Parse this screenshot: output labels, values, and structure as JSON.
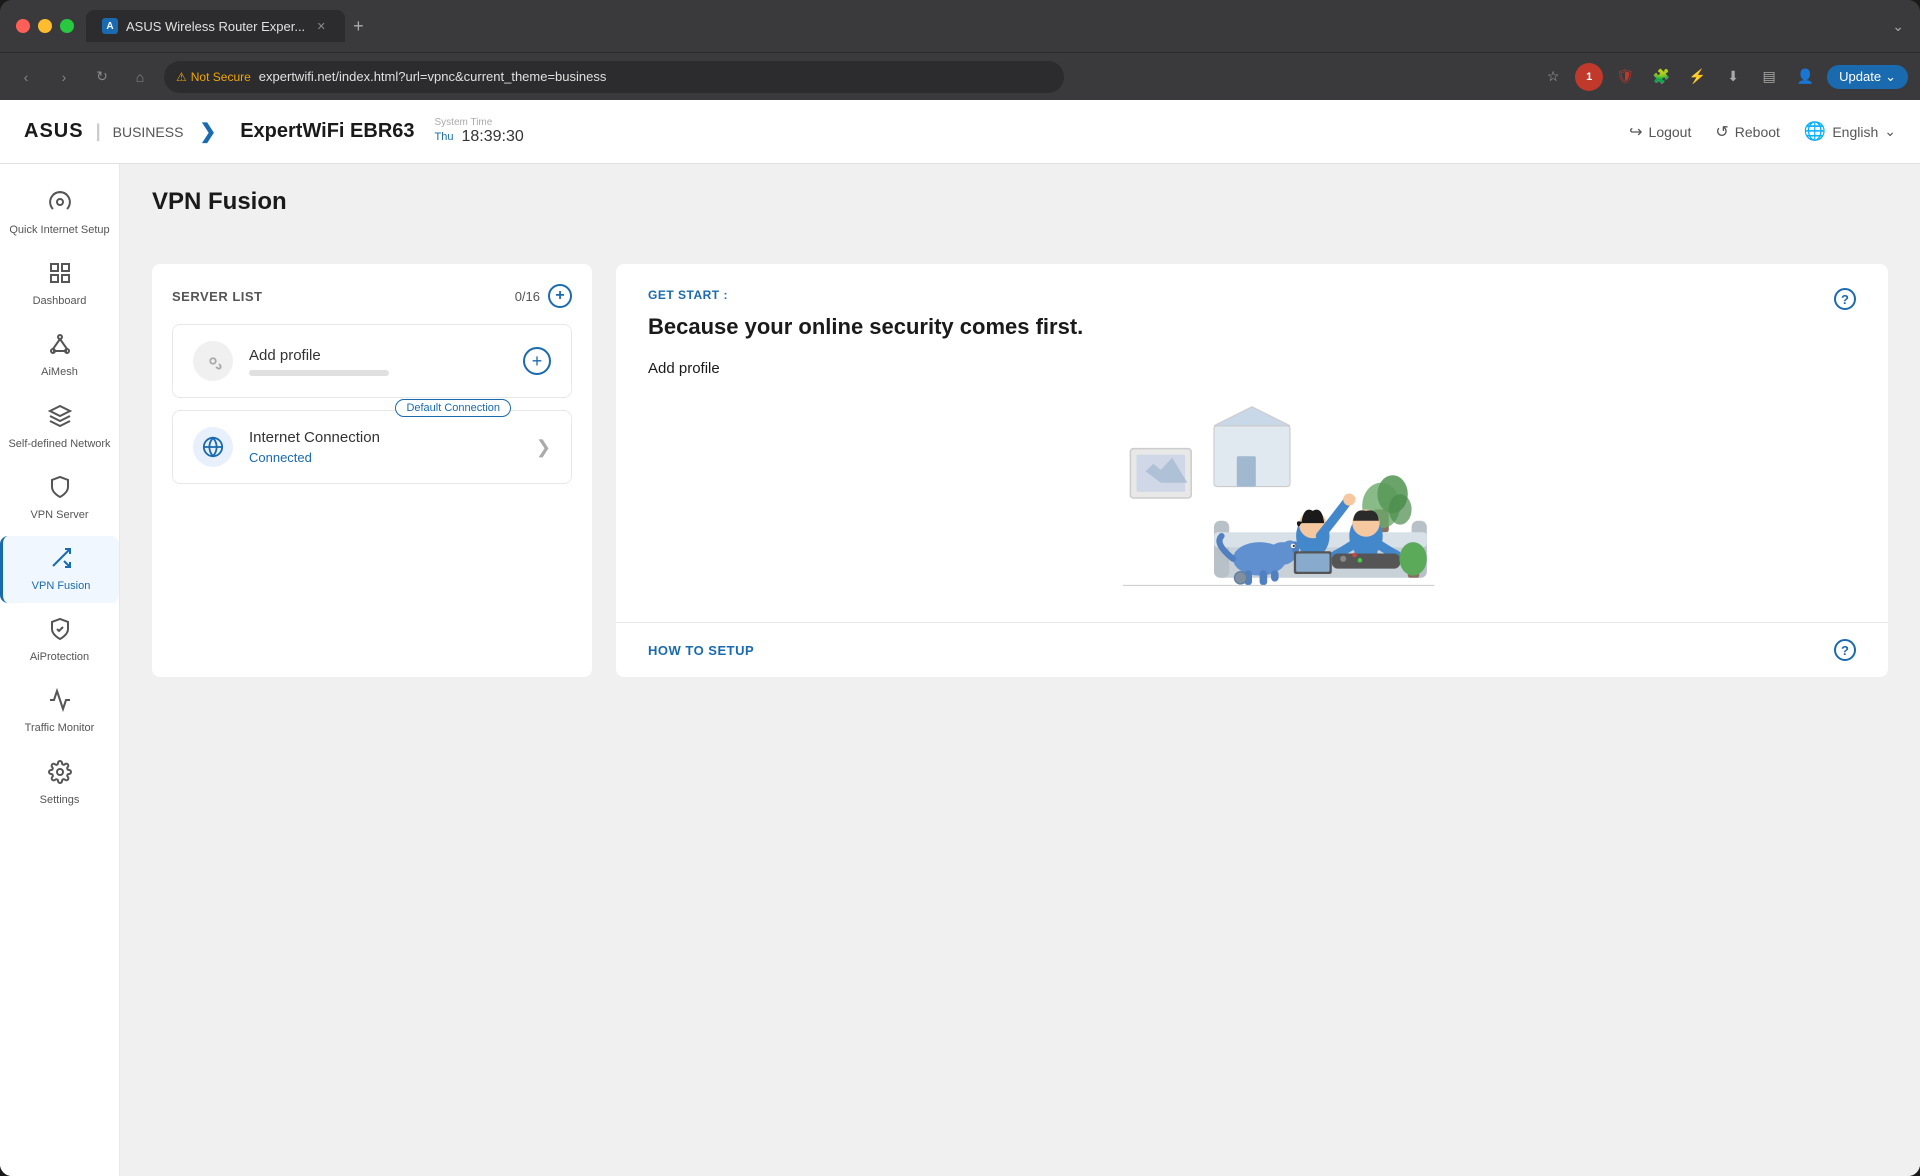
{
  "browser": {
    "tab_title": "ASUS Wireless Router Exper...",
    "tab_icon": "A",
    "address": "expertwifi.net/index.html?url=vpnc&current_theme=business",
    "not_secure_label": "Not Secure",
    "update_button": "Update",
    "new_tab_title": "New Tab"
  },
  "app_header": {
    "logo_text": "ASUS",
    "divider": "|",
    "business_label": "BUSINESS",
    "chevron": "❯",
    "router_name": "ExpertWiFi EBR63",
    "system_time_label": "System Time",
    "system_time_day": "Thu",
    "system_time_value": "18:39:30",
    "logout_label": "Logout",
    "reboot_label": "Reboot",
    "language_label": "English"
  },
  "sidebar": {
    "items": [
      {
        "id": "quick-internet-setup",
        "label": "Quick Internet Setup",
        "icon": "⚙",
        "active": false
      },
      {
        "id": "dashboard",
        "label": "Dashboard",
        "icon": "📊",
        "active": false
      },
      {
        "id": "aimesh",
        "label": "AiMesh",
        "icon": "📡",
        "active": false
      },
      {
        "id": "self-defined-network",
        "label": "Self-defined Network",
        "icon": "🔧",
        "active": false
      },
      {
        "id": "vpn-server",
        "label": "VPN Server",
        "icon": "🛡",
        "active": false
      },
      {
        "id": "vpn-fusion",
        "label": "VPN Fusion",
        "icon": "🔀",
        "active": true
      },
      {
        "id": "aiprotection",
        "label": "AiProtection",
        "icon": "🔒",
        "active": false
      },
      {
        "id": "traffic-monitor",
        "label": "Traffic Monitor",
        "icon": "📈",
        "active": false
      },
      {
        "id": "settings",
        "label": "Settings",
        "icon": "⚙",
        "active": false
      }
    ]
  },
  "page": {
    "title": "VPN Fusion",
    "help_icon": "?"
  },
  "server_list": {
    "title": "SERVER LIST",
    "count": "0/16",
    "add_icon": "+",
    "add_profile": {
      "name": "Add profile",
      "icon": "🔄"
    },
    "internet_connection": {
      "name": "Internet Connection",
      "status": "Connected",
      "default_connection_badge": "Default Connection",
      "icon": "🌐",
      "arrow": "❯"
    }
  },
  "get_start": {
    "label": "GET START :",
    "title": "Because your online security comes first.",
    "add_profile_btn": "Add profile",
    "help_icon": "?"
  },
  "how_to_setup": {
    "label": "HOW TO SETUP",
    "help_icon": "?"
  }
}
